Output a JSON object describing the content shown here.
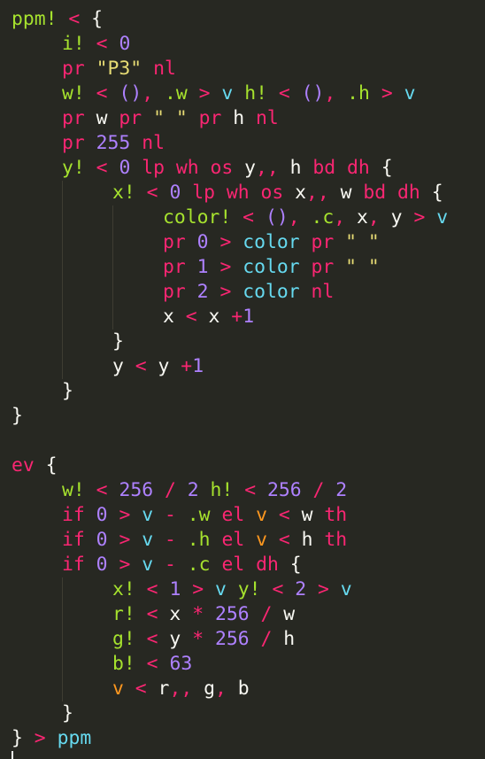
{
  "colors": {
    "background": "#272822",
    "plain": "#f8f8f2",
    "keyword": "#f92672",
    "number": "#ae81ff",
    "string": "#e6db74",
    "declaration": "#a6e22e",
    "builtin": "#66d9ef",
    "variable": "#fd971f",
    "indent_guide": "#3e3d32"
  },
  "lines": [
    {
      "indent": 0,
      "tokens": [
        [
          "ppm!",
          "declaration"
        ],
        [
          " ",
          "plain"
        ],
        [
          "<",
          "keyword"
        ],
        [
          " {",
          "plain"
        ]
      ]
    },
    {
      "indent": 1,
      "tokens": [
        [
          "i!",
          "declaration"
        ],
        [
          " ",
          "plain"
        ],
        [
          "<",
          "keyword"
        ],
        [
          " ",
          "plain"
        ],
        [
          "0",
          "number"
        ]
      ]
    },
    {
      "indent": 1,
      "tokens": [
        [
          "pr",
          "keyword"
        ],
        [
          " ",
          "plain"
        ],
        [
          "\"P3\"",
          "string"
        ],
        [
          " ",
          "plain"
        ],
        [
          "nl",
          "keyword"
        ]
      ]
    },
    {
      "indent": 1,
      "tokens": [
        [
          "w!",
          "declaration"
        ],
        [
          " ",
          "plain"
        ],
        [
          "<",
          "keyword"
        ],
        [
          " ",
          "plain"
        ],
        [
          "()",
          "number"
        ],
        [
          ", ",
          "keyword"
        ],
        [
          ".w",
          "declaration"
        ],
        [
          " ",
          "plain"
        ],
        [
          ">",
          "keyword"
        ],
        [
          " ",
          "plain"
        ],
        [
          "v",
          "builtin"
        ],
        [
          " ",
          "plain"
        ],
        [
          "h!",
          "declaration"
        ],
        [
          " ",
          "plain"
        ],
        [
          "<",
          "keyword"
        ],
        [
          " ",
          "plain"
        ],
        [
          "()",
          "number"
        ],
        [
          ", ",
          "keyword"
        ],
        [
          ".h",
          "declaration"
        ],
        [
          " ",
          "plain"
        ],
        [
          ">",
          "keyword"
        ],
        [
          " ",
          "plain"
        ],
        [
          "v",
          "builtin"
        ]
      ]
    },
    {
      "indent": 1,
      "tokens": [
        [
          "pr",
          "keyword"
        ],
        [
          " w ",
          "plain"
        ],
        [
          "pr",
          "keyword"
        ],
        [
          " ",
          "plain"
        ],
        [
          "\" \"",
          "string"
        ],
        [
          " ",
          "plain"
        ],
        [
          "pr",
          "keyword"
        ],
        [
          " h ",
          "plain"
        ],
        [
          "nl",
          "keyword"
        ]
      ]
    },
    {
      "indent": 1,
      "tokens": [
        [
          "pr",
          "keyword"
        ],
        [
          " ",
          "plain"
        ],
        [
          "255",
          "number"
        ],
        [
          " ",
          "plain"
        ],
        [
          "nl",
          "keyword"
        ]
      ]
    },
    {
      "indent": 1,
      "tokens": [
        [
          "y!",
          "declaration"
        ],
        [
          " ",
          "plain"
        ],
        [
          "<",
          "keyword"
        ],
        [
          " ",
          "plain"
        ],
        [
          "0",
          "number"
        ],
        [
          " ",
          "plain"
        ],
        [
          "lp wh os",
          "keyword"
        ],
        [
          " y",
          "plain"
        ],
        [
          ",,",
          "keyword"
        ],
        [
          " h ",
          "plain"
        ],
        [
          "bd dh",
          "keyword"
        ],
        [
          " {",
          "plain"
        ]
      ]
    },
    {
      "indent": 2,
      "tokens": [
        [
          "x!",
          "declaration"
        ],
        [
          " ",
          "plain"
        ],
        [
          "<",
          "keyword"
        ],
        [
          " ",
          "plain"
        ],
        [
          "0",
          "number"
        ],
        [
          " ",
          "plain"
        ],
        [
          "lp wh os",
          "keyword"
        ],
        [
          " x",
          "plain"
        ],
        [
          ",,",
          "keyword"
        ],
        [
          " w ",
          "plain"
        ],
        [
          "bd dh",
          "keyword"
        ],
        [
          " {",
          "plain"
        ]
      ]
    },
    {
      "indent": 3,
      "tokens": [
        [
          "color!",
          "declaration"
        ],
        [
          " ",
          "plain"
        ],
        [
          "<",
          "keyword"
        ],
        [
          " ",
          "plain"
        ],
        [
          "()",
          "number"
        ],
        [
          ", ",
          "keyword"
        ],
        [
          ".c",
          "declaration"
        ],
        [
          ", ",
          "keyword"
        ],
        [
          "x",
          "plain"
        ],
        [
          ", ",
          "keyword"
        ],
        [
          "y",
          "plain"
        ],
        [
          " ",
          "plain"
        ],
        [
          ">",
          "keyword"
        ],
        [
          " ",
          "plain"
        ],
        [
          "v",
          "builtin"
        ]
      ]
    },
    {
      "indent": 3,
      "tokens": [
        [
          "pr",
          "keyword"
        ],
        [
          " ",
          "plain"
        ],
        [
          "0",
          "number"
        ],
        [
          " ",
          "plain"
        ],
        [
          ">",
          "keyword"
        ],
        [
          " ",
          "plain"
        ],
        [
          "color",
          "builtin"
        ],
        [
          " ",
          "plain"
        ],
        [
          "pr",
          "keyword"
        ],
        [
          " ",
          "plain"
        ],
        [
          "\" \"",
          "string"
        ]
      ]
    },
    {
      "indent": 3,
      "tokens": [
        [
          "pr",
          "keyword"
        ],
        [
          " ",
          "plain"
        ],
        [
          "1",
          "number"
        ],
        [
          " ",
          "plain"
        ],
        [
          ">",
          "keyword"
        ],
        [
          " ",
          "plain"
        ],
        [
          "color",
          "builtin"
        ],
        [
          " ",
          "plain"
        ],
        [
          "pr",
          "keyword"
        ],
        [
          " ",
          "plain"
        ],
        [
          "\" \"",
          "string"
        ]
      ]
    },
    {
      "indent": 3,
      "tokens": [
        [
          "pr",
          "keyword"
        ],
        [
          " ",
          "plain"
        ],
        [
          "2",
          "number"
        ],
        [
          " ",
          "plain"
        ],
        [
          ">",
          "keyword"
        ],
        [
          " ",
          "plain"
        ],
        [
          "color",
          "builtin"
        ],
        [
          " ",
          "plain"
        ],
        [
          "nl",
          "keyword"
        ]
      ]
    },
    {
      "indent": 3,
      "tokens": [
        [
          "x ",
          "plain"
        ],
        [
          "<",
          "keyword"
        ],
        [
          " x ",
          "plain"
        ],
        [
          "+",
          "keyword"
        ],
        [
          "1",
          "number"
        ]
      ]
    },
    {
      "indent": 2,
      "tokens": [
        [
          "}",
          "plain"
        ]
      ]
    },
    {
      "indent": 2,
      "tokens": [
        [
          "y ",
          "plain"
        ],
        [
          "<",
          "keyword"
        ],
        [
          " y ",
          "plain"
        ],
        [
          "+",
          "keyword"
        ],
        [
          "1",
          "number"
        ]
      ]
    },
    {
      "indent": 1,
      "tokens": [
        [
          "}",
          "plain"
        ]
      ]
    },
    {
      "indent": 0,
      "tokens": [
        [
          "}",
          "plain"
        ]
      ]
    },
    {
      "indent": 0,
      "tokens": []
    },
    {
      "indent": 0,
      "tokens": [
        [
          "ev",
          "keyword"
        ],
        [
          " {",
          "plain"
        ]
      ]
    },
    {
      "indent": 1,
      "tokens": [
        [
          "w!",
          "declaration"
        ],
        [
          " ",
          "plain"
        ],
        [
          "<",
          "keyword"
        ],
        [
          " ",
          "plain"
        ],
        [
          "256",
          "number"
        ],
        [
          " ",
          "plain"
        ],
        [
          "/",
          "keyword"
        ],
        [
          " ",
          "plain"
        ],
        [
          "2",
          "number"
        ],
        [
          " ",
          "plain"
        ],
        [
          "h!",
          "declaration"
        ],
        [
          " ",
          "plain"
        ],
        [
          "<",
          "keyword"
        ],
        [
          " ",
          "plain"
        ],
        [
          "256",
          "number"
        ],
        [
          " ",
          "plain"
        ],
        [
          "/",
          "keyword"
        ],
        [
          " ",
          "plain"
        ],
        [
          "2",
          "number"
        ]
      ]
    },
    {
      "indent": 1,
      "tokens": [
        [
          "if",
          "keyword"
        ],
        [
          " ",
          "plain"
        ],
        [
          "0",
          "number"
        ],
        [
          " ",
          "plain"
        ],
        [
          ">",
          "keyword"
        ],
        [
          " ",
          "plain"
        ],
        [
          "v",
          "builtin"
        ],
        [
          " ",
          "plain"
        ],
        [
          "-",
          "keyword"
        ],
        [
          " ",
          "plain"
        ],
        [
          ".w",
          "declaration"
        ],
        [
          " ",
          "plain"
        ],
        [
          "el",
          "keyword"
        ],
        [
          " ",
          "plain"
        ],
        [
          "v",
          "variable"
        ],
        [
          " ",
          "plain"
        ],
        [
          "<",
          "keyword"
        ],
        [
          " w ",
          "plain"
        ],
        [
          "th",
          "keyword"
        ]
      ]
    },
    {
      "indent": 1,
      "tokens": [
        [
          "if",
          "keyword"
        ],
        [
          " ",
          "plain"
        ],
        [
          "0",
          "number"
        ],
        [
          " ",
          "plain"
        ],
        [
          ">",
          "keyword"
        ],
        [
          " ",
          "plain"
        ],
        [
          "v",
          "builtin"
        ],
        [
          " ",
          "plain"
        ],
        [
          "-",
          "keyword"
        ],
        [
          " ",
          "plain"
        ],
        [
          ".h",
          "declaration"
        ],
        [
          " ",
          "plain"
        ],
        [
          "el",
          "keyword"
        ],
        [
          " ",
          "plain"
        ],
        [
          "v",
          "variable"
        ],
        [
          " ",
          "plain"
        ],
        [
          "<",
          "keyword"
        ],
        [
          " h ",
          "plain"
        ],
        [
          "th",
          "keyword"
        ]
      ]
    },
    {
      "indent": 1,
      "tokens": [
        [
          "if",
          "keyword"
        ],
        [
          " ",
          "plain"
        ],
        [
          "0",
          "number"
        ],
        [
          " ",
          "plain"
        ],
        [
          ">",
          "keyword"
        ],
        [
          " ",
          "plain"
        ],
        [
          "v",
          "builtin"
        ],
        [
          " ",
          "plain"
        ],
        [
          "-",
          "keyword"
        ],
        [
          " ",
          "plain"
        ],
        [
          ".c",
          "declaration"
        ],
        [
          " ",
          "plain"
        ],
        [
          "el dh",
          "keyword"
        ],
        [
          " {",
          "plain"
        ]
      ]
    },
    {
      "indent": 2,
      "tokens": [
        [
          "x!",
          "declaration"
        ],
        [
          " ",
          "plain"
        ],
        [
          "<",
          "keyword"
        ],
        [
          " ",
          "plain"
        ],
        [
          "1",
          "number"
        ],
        [
          " ",
          "plain"
        ],
        [
          ">",
          "keyword"
        ],
        [
          " ",
          "plain"
        ],
        [
          "v",
          "builtin"
        ],
        [
          " ",
          "plain"
        ],
        [
          "y!",
          "declaration"
        ],
        [
          " ",
          "plain"
        ],
        [
          "<",
          "keyword"
        ],
        [
          " ",
          "plain"
        ],
        [
          "2",
          "number"
        ],
        [
          " ",
          "plain"
        ],
        [
          ">",
          "keyword"
        ],
        [
          " ",
          "plain"
        ],
        [
          "v",
          "builtin"
        ]
      ]
    },
    {
      "indent": 2,
      "tokens": [
        [
          "r!",
          "declaration"
        ],
        [
          " ",
          "plain"
        ],
        [
          "<",
          "keyword"
        ],
        [
          " x ",
          "plain"
        ],
        [
          "*",
          "keyword"
        ],
        [
          " ",
          "plain"
        ],
        [
          "256",
          "number"
        ],
        [
          " ",
          "plain"
        ],
        [
          "/",
          "keyword"
        ],
        [
          " w",
          "plain"
        ]
      ]
    },
    {
      "indent": 2,
      "tokens": [
        [
          "g!",
          "declaration"
        ],
        [
          " ",
          "plain"
        ],
        [
          "<",
          "keyword"
        ],
        [
          " y ",
          "plain"
        ],
        [
          "*",
          "keyword"
        ],
        [
          " ",
          "plain"
        ],
        [
          "256",
          "number"
        ],
        [
          " ",
          "plain"
        ],
        [
          "/",
          "keyword"
        ],
        [
          " h",
          "plain"
        ]
      ]
    },
    {
      "indent": 2,
      "tokens": [
        [
          "b!",
          "declaration"
        ],
        [
          " ",
          "plain"
        ],
        [
          "<",
          "keyword"
        ],
        [
          " ",
          "plain"
        ],
        [
          "63",
          "number"
        ]
      ]
    },
    {
      "indent": 2,
      "tokens": [
        [
          "v",
          "variable"
        ],
        [
          " ",
          "plain"
        ],
        [
          "<",
          "keyword"
        ],
        [
          " r",
          "plain"
        ],
        [
          ",,",
          "keyword"
        ],
        [
          " g",
          "plain"
        ],
        [
          ", ",
          "keyword"
        ],
        [
          "b",
          "plain"
        ]
      ]
    },
    {
      "indent": 1,
      "tokens": [
        [
          "}",
          "plain"
        ]
      ]
    },
    {
      "indent": 0,
      "tokens": [
        [
          "}",
          "plain"
        ],
        [
          " ",
          "plain"
        ],
        [
          ">",
          "keyword"
        ],
        [
          " ",
          "plain"
        ],
        [
          "ppm",
          "builtin"
        ]
      ]
    }
  ]
}
